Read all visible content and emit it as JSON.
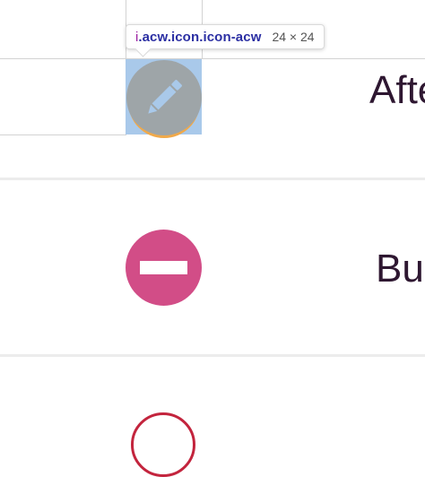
{
  "tooltip": {
    "tag": "i",
    "selector": ".acw.icon.icon-acw",
    "dimensions": "24 × 24"
  },
  "rows": [
    {
      "label": "Afte",
      "icon": "edit-pencil-icon",
      "icon_color": "#9ea5a8"
    },
    {
      "label": "Bus",
      "icon": "minus-circle-icon",
      "icon_color": "#d24d87"
    },
    {
      "label": "",
      "icon": "circle-outline-icon",
      "icon_color": "#c3243d"
    }
  ],
  "colors": {
    "highlight": "#a9c9ea",
    "text": "#2e1731",
    "selector_text": "#2b2fa3",
    "tag_text": "#9b1fa1"
  }
}
